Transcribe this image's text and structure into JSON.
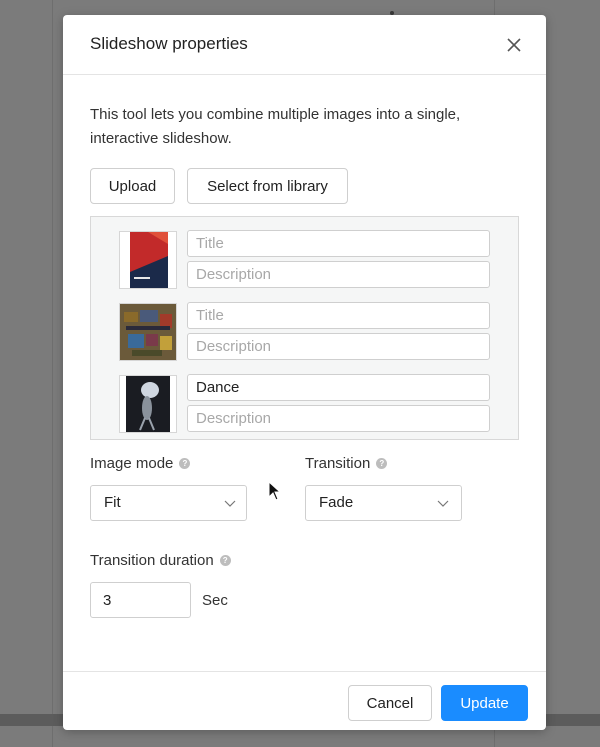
{
  "dialog": {
    "title": "Slideshow properties",
    "intro": "This tool lets you combine multiple images into a single, interactive slideshow.",
    "upload_label": "Upload",
    "library_label": "Select from library"
  },
  "images": [
    {
      "title_value": "",
      "title_placeholder": "Title",
      "description_value": "",
      "description_placeholder": "Description"
    },
    {
      "title_value": "",
      "title_placeholder": "Title",
      "description_value": "",
      "description_placeholder": "Description"
    },
    {
      "title_value": "Dance",
      "title_placeholder": "Title",
      "description_value": "",
      "description_placeholder": "Description"
    }
  ],
  "image_mode": {
    "label": "Image mode",
    "value": "Fit",
    "help_icon": "question-icon"
  },
  "transition": {
    "label": "Transition",
    "value": "Fade",
    "help_icon": "question-icon"
  },
  "duration": {
    "label": "Transition duration",
    "value": "3",
    "unit": "Sec",
    "help_icon": "question-icon"
  },
  "footer": {
    "cancel_label": "Cancel",
    "update_label": "Update"
  },
  "colors": {
    "accent": "#1a8cff",
    "backdrop": "#7b7b7b"
  }
}
